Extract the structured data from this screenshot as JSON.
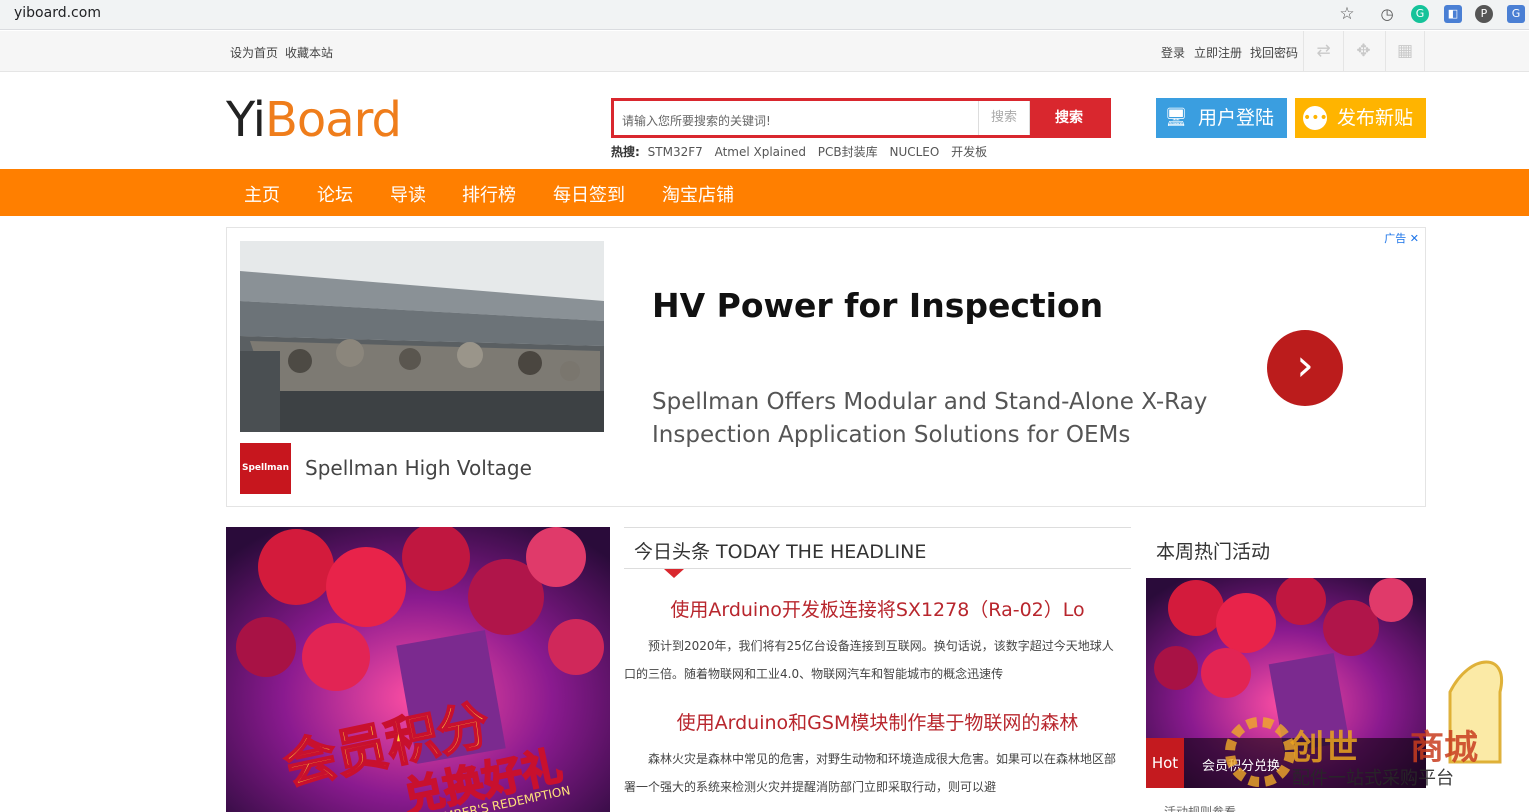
{
  "browser": {
    "url": "yiboard.com"
  },
  "topbar": {
    "left": [
      "设为首页",
      "收藏本站"
    ],
    "right": [
      "登录",
      "立即注册",
      "找回密码"
    ]
  },
  "header": {
    "logo_part1": "Yi",
    "logo_part2": "Board",
    "search_placeholder": "请输入您所要搜索的关键词!",
    "search_scope": "搜索",
    "search_button": "搜索",
    "hot_label": "热搜:",
    "hot_terms": [
      "STM32F7",
      "Atmel Xplained",
      "PCB封装库",
      "NUCLEO",
      "开发板"
    ],
    "login_button": "用户登陆",
    "post_button": "发布新贴"
  },
  "nav": [
    "主页",
    "论坛",
    "导读",
    "排行榜",
    "每日签到",
    "淘宝店铺"
  ],
  "ad": {
    "label": "广告",
    "title": "HV Power for Inspection",
    "description": "Spellman Offers Modular and Stand-Alone X-Ray Inspection Application Solutions for OEMs",
    "brand": "Spellman High Voltage",
    "brand_logo": "Spellman"
  },
  "headline": {
    "heading": "今日头条 TODAY THE HEADLINE",
    "articles": [
      {
        "title": "使用Arduino开发板连接将SX1278（Ra-02）Lo",
        "desc": "预计到2020年，我们将有25亿台设备连接到互联网。换句话说，该数字超过今天地球人口的三倍。随着物联网和工业4.0、物联网汽车和智能城市的概念迅速传"
      },
      {
        "title": "使用Arduino和GSM模块制作基于物联网的森林",
        "desc": "森林火灾是森林中常见的危害，对野生动物和环境造成很大危害。如果可以在森林地区部署一个强大的系统来检测火灾并提醒消防部门立即采取行动，则可以避"
      }
    ]
  },
  "side": {
    "title": "本周热门活动",
    "hot_tag": "Hot",
    "hot_text": "会员积分兑换",
    "rule": "活动规则参看"
  },
  "promo": {
    "text_main": "会员积分",
    "text_sub": "兑换好礼",
    "banner": "MEMBER'S REDEMPTION"
  },
  "watermark": {
    "line1a": "创世",
    "line1b": "商城",
    "line2": "配件一站式采购平台"
  },
  "colors": {
    "nav": "#ff7f00",
    "accent_red": "#d9272e",
    "login": "#3a9ee0",
    "post": "#ffb400"
  }
}
